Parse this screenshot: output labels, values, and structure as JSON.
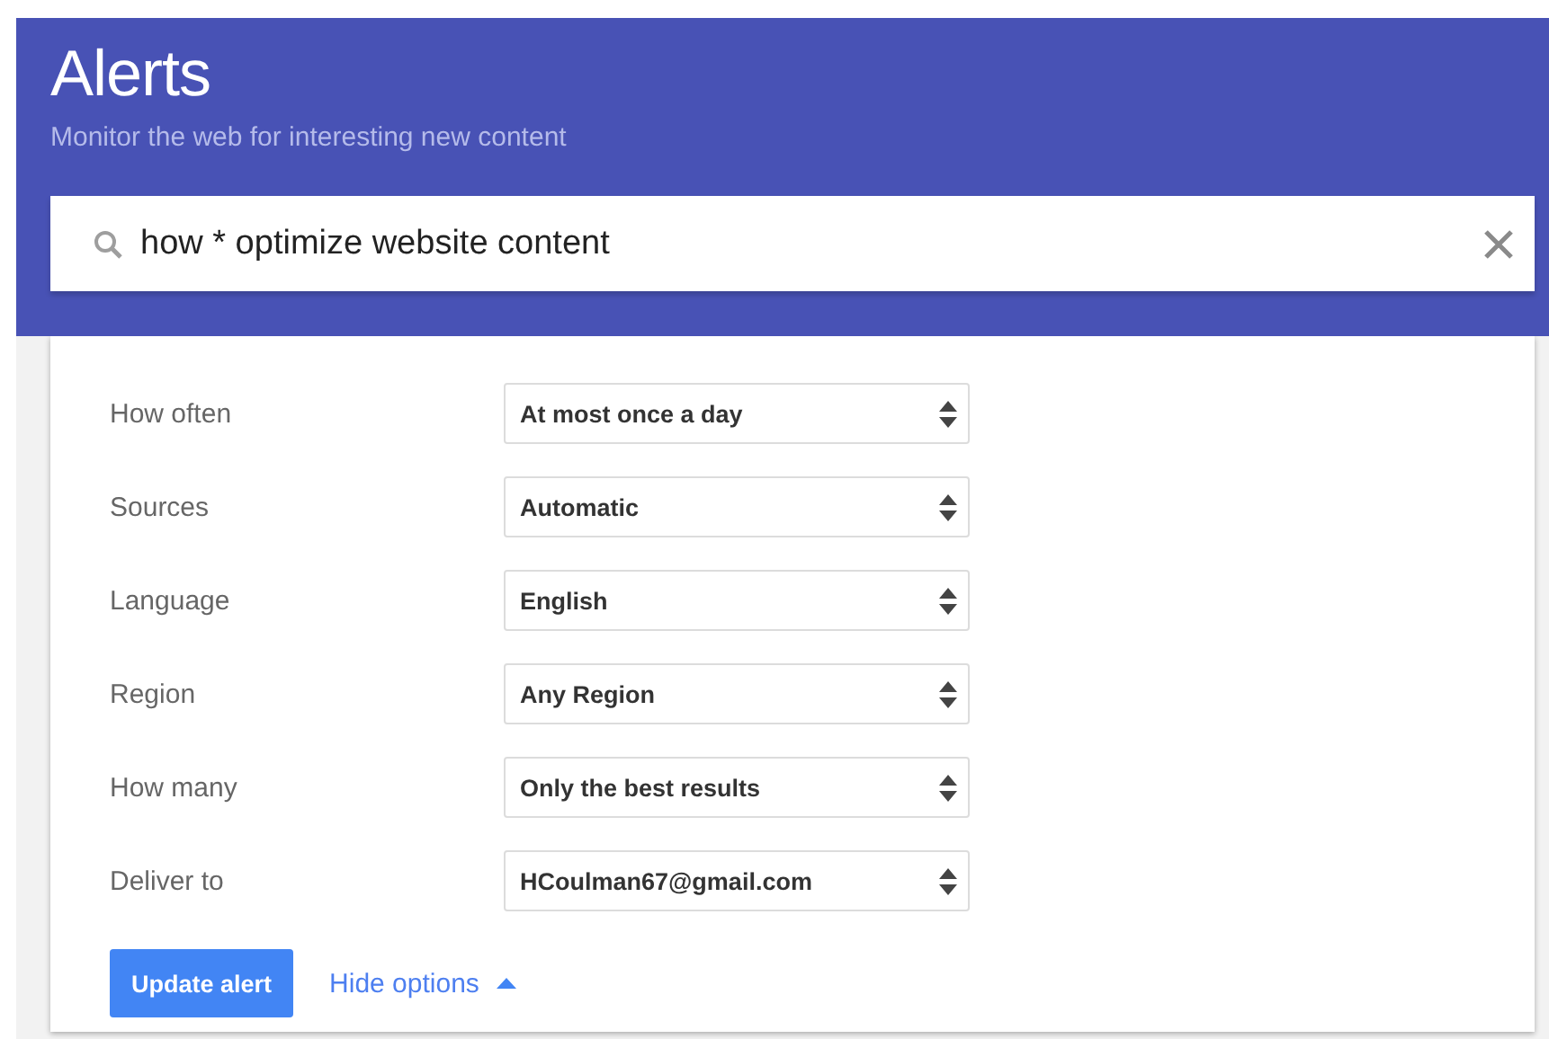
{
  "header": {
    "title": "Alerts",
    "subtitle": "Monitor the web for interesting new content"
  },
  "search": {
    "value": "how * optimize website content"
  },
  "options": [
    {
      "label": "How often",
      "value": "At most once a day"
    },
    {
      "label": "Sources",
      "value": "Automatic"
    },
    {
      "label": "Language",
      "value": "English"
    },
    {
      "label": "Region",
      "value": "Any Region"
    },
    {
      "label": "How many",
      "value": "Only the best results"
    },
    {
      "label": "Deliver to",
      "value": "HCoulman67@gmail.com"
    }
  ],
  "update_button": "Update alert",
  "hide_options": {
    "label": "Hide options",
    "expanded": true
  }
}
